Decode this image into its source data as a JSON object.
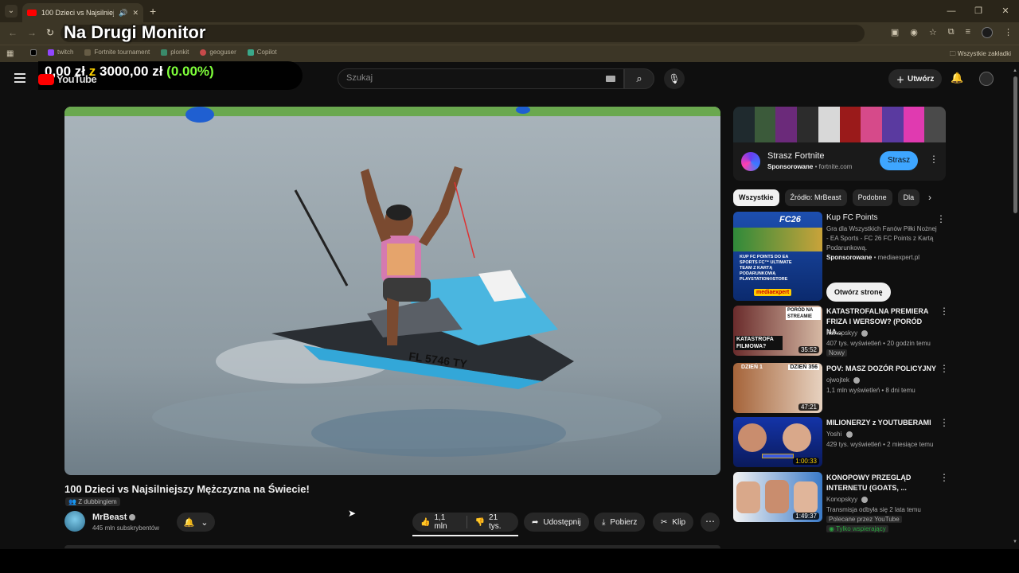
{
  "browser": {
    "tab_title": "100 Dzieci vs Najsilniejszy Mężczyzna na Świecie!",
    "new_tab": "+",
    "bookmarks": [
      "twitch",
      "Fortnite tournament",
      "plonkit",
      "geoguser",
      "Copilot"
    ],
    "all_bookmarks": "Wszystkie zakładki"
  },
  "overlay": {
    "monitor_label": "Na Drugi Monitor",
    "money_current": "0,00 zł",
    "money_joiner": "z",
    "money_target": "3000,00 zł",
    "money_percent": "(0.00%)"
  },
  "header": {
    "logo_text": "YouTube",
    "search_placeholder": "Szukaj",
    "create_label": "Utwórz"
  },
  "video": {
    "title": "100 Dzieci vs Najsilniejszy Mężczyzna na Świecie!",
    "dubbing_label": "Z dubbingiem",
    "jetski_reg": "FL 5746 TY",
    "channel_name": "MrBeast",
    "channel_subs": "445 mln subskrybentów",
    "likes": "1,1 mln",
    "dislikes": "21 tys.",
    "share_label": "Udostępnij",
    "download_label": "Pobierz",
    "clip_label": "Klip"
  },
  "sidebar": {
    "ad": {
      "title": "Strasz Fortnite",
      "sponsored": "Sponsorowane",
      "domain": "fortnite.com",
      "cta": "Strasz",
      "banner_colors": [
        "#1f2a2e",
        "#3b5a3a",
        "#6b2a7a",
        "#2c2c2c",
        "#d8d8d8",
        "#9a1a1a",
        "#d64a8a",
        "#5a3aa0",
        "#e03ab0",
        "#4a4a4a"
      ]
    },
    "chips": [
      "Wszystkie",
      "Źródło: MrBeast",
      "Podobne",
      "Dla"
    ],
    "promo": {
      "title": "Kup FC Points",
      "desc": "Gra dla Wszystkich Fanów Piłki Nożnej - EA Sports - FC 26 FC Points z Kartą Podarunkową.",
      "sponsored": "Sponsorowane",
      "domain": "mediaexpert.pl",
      "button": "Otwórz stronę",
      "thumb_logo": "FC26",
      "thumb_text": "KUP FC POINTS DO EA SPORTS FC™ ULTIMATE TEAM Z KARTĄ PODARUNKOWĄ PLAYSTATION®STORE",
      "thumb_brand": "mediaexpert"
    },
    "recs": [
      {
        "title": "KATASTROFALNA PREMIERA FRIZA I WERSOW? (PORÓD NA...",
        "channel": "Konopskyy",
        "meta": "407 tys. wyświetleń • 20 godzin temu",
        "badge": "Nowy",
        "duration": "35:52",
        "thumb_text": "KATASTROFA FILMOWA?",
        "thumb_text2": "PORÓD NA STREAMIE",
        "color_a": "#6a2c2c",
        "color_b": "#d6b9a4"
      },
      {
        "title": "POV: MASZ DOZÓR POLICYJNY",
        "channel": "ojwojtek",
        "meta": "1,1 mln wyświetleń • 8 dni temu",
        "badge": "",
        "duration": "47:21",
        "thumb_text": "DZIEŃ 1",
        "thumb_text2": "DZIEŃ 356",
        "color_a": "#a5643a",
        "color_b": "#e7d2c0"
      },
      {
        "title": "MILIONERZY z YOUTUBERAMI",
        "channel": "Yoshi",
        "meta": "429 tys. wyświetleń • 2 miesiące temu",
        "badge": "",
        "duration": "1:00:33",
        "thumb_text": "",
        "thumb_text2": "",
        "color_a": "#1434a8",
        "color_b": "#0a1a5c"
      },
      {
        "title": "KONOPOWY PRZEGLĄD INTERNETU (GOATS, ...",
        "channel": "Konopskyy",
        "meta": "Transmisja odbyła się 2 lata temu",
        "badge": "Polecane przez YouTube",
        "badge2": "Tylko wspierający",
        "duration": "1:49:37",
        "thumb_text": "",
        "thumb_text2": "",
        "color_a": "#3a7ac8",
        "color_b": "#f2f2f2"
      }
    ]
  },
  "colors": {
    "yt_red": "#ff0000",
    "accent_blue": "#3ea6ff",
    "chrome_bg": "#3c3626",
    "page_bg": "#0f0f0f"
  }
}
